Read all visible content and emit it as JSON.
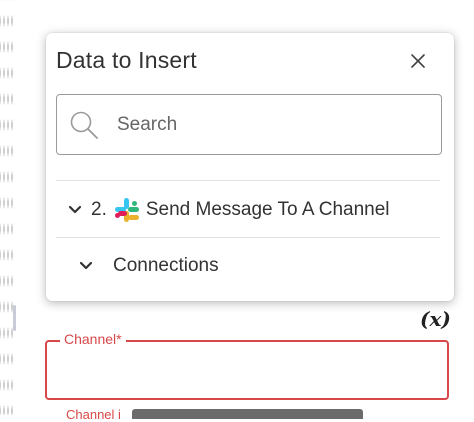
{
  "popup": {
    "title": "Data to Insert",
    "close_label": "×",
    "search": {
      "placeholder": "Search",
      "value": ""
    },
    "tree": [
      {
        "number": "2.",
        "label": "Send Message To A Channel",
        "icon": "slack-icon"
      },
      {
        "label": "Connections"
      }
    ]
  },
  "form": {
    "variable_toggle": "(x)",
    "channel_label": "Channel*",
    "channel_value": "",
    "partial_label": "Channel i"
  },
  "colors": {
    "error": "#d84848",
    "slack_blue": "#36C5F0",
    "slack_green": "#2EB67D",
    "slack_red": "#E01E5A",
    "slack_yellow": "#ECB22E"
  }
}
